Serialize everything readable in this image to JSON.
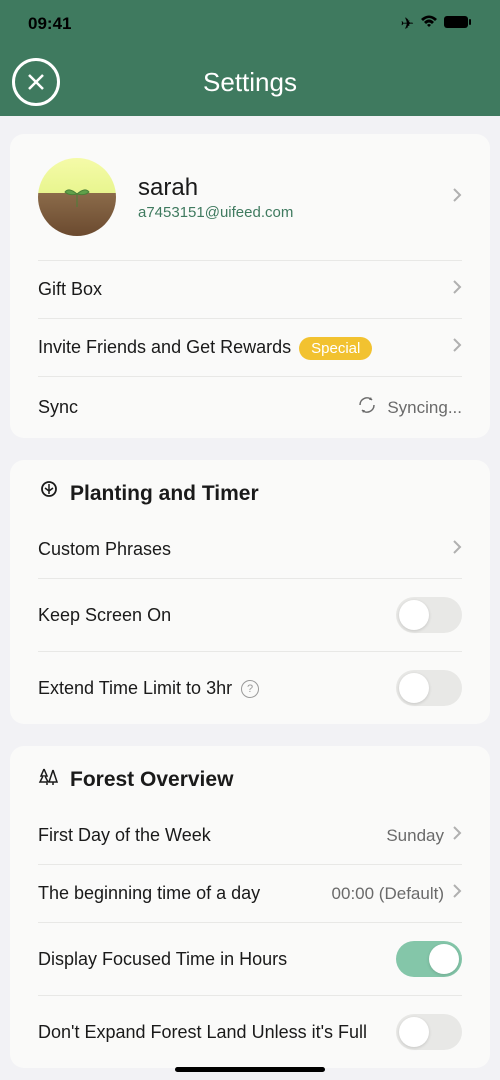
{
  "status": {
    "time": "09:41"
  },
  "header": {
    "title": "Settings"
  },
  "profile": {
    "name": "sarah",
    "email": "a7453151@uifeed.com"
  },
  "account": {
    "giftbox": "Gift Box",
    "invite": "Invite Friends and Get Rewards",
    "invite_badge": "Special",
    "sync_label": "Sync",
    "sync_status": "Syncing..."
  },
  "planting": {
    "title": "Planting and Timer",
    "custom_phrases": "Custom Phrases",
    "keep_screen": "Keep Screen On",
    "extend_time": "Extend Time Limit to 3hr"
  },
  "forest": {
    "title": "Forest Overview",
    "first_day_label": "First Day of the Week",
    "first_day_value": "Sunday",
    "begin_time_label": "The beginning time of a day",
    "begin_time_value": "00:00 (Default)",
    "display_hours": "Display Focused Time in Hours",
    "dont_expand": "Don't Expand Forest Land Unless it's Full"
  },
  "toggles": {
    "keep_screen": false,
    "extend_time": false,
    "display_hours": true,
    "dont_expand": false
  }
}
